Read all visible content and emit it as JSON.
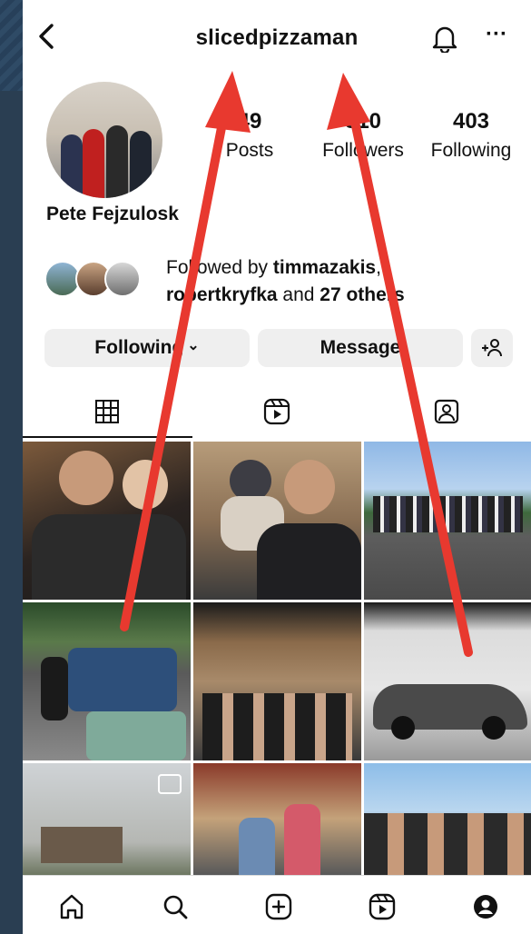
{
  "header": {
    "username": "slicedpizzaman",
    "back_icon": "chevron-left-icon",
    "bell_icon": "bell-icon",
    "more_icon": "more-dots-icon",
    "more_glyph": "···"
  },
  "profile": {
    "name": "Pete Fejzulosk",
    "stats": [
      {
        "value": "49",
        "label": "Posts"
      },
      {
        "value": "310",
        "label": "Followers"
      },
      {
        "value": "403",
        "label": "Following"
      }
    ],
    "followed_by": {
      "prefix": "Followed by ",
      "user1": "timmazakis",
      "sep": ",",
      "user2": "robertkryfka",
      "and": " and ",
      "others": "27 others"
    }
  },
  "actions": {
    "following_label": "Following",
    "following_chevron": "⌄",
    "message_label": "Message",
    "add_person_icon": "add-person-icon"
  },
  "tabs": [
    {
      "icon": "grid-icon"
    },
    {
      "icon": "reels-icon"
    },
    {
      "icon": "tagged-icon"
    }
  ],
  "grid": {
    "post_count_shown": 9,
    "reel_badge_icon": "reel-icon"
  },
  "bottom_nav": [
    {
      "icon": "home-icon"
    },
    {
      "icon": "search-icon"
    },
    {
      "icon": "create-icon"
    },
    {
      "icon": "reels-icon"
    },
    {
      "icon": "profile-icon"
    }
  ],
  "colors": {
    "annotation_arrow": "#e8392f",
    "button_bg": "#efefef",
    "outer_bg": "#2a3e52"
  }
}
